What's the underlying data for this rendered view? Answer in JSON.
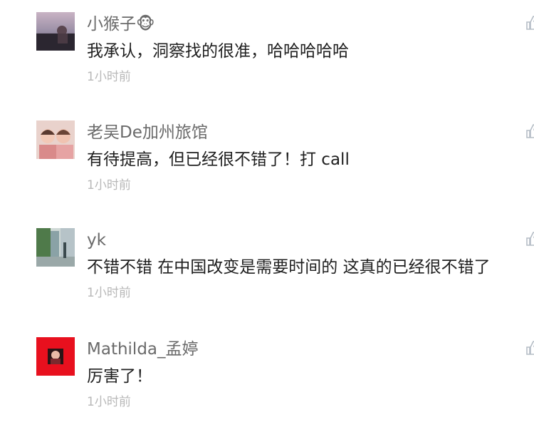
{
  "comments": [
    {
      "name": "小猴子🐵",
      "text": "我承认，洞察找的很准，哈哈哈哈哈",
      "time": "1小时前",
      "avatar_icon": "avatar-sunset-photo",
      "like_icon": "thumbs-up-icon"
    },
    {
      "name": "老吴De加州旅馆",
      "text": "有待提高，但已经很不错了！打 call",
      "time": "1小时前",
      "avatar_icon": "avatar-children-photo",
      "like_icon": "thumbs-up-icon"
    },
    {
      "name": "yk",
      "text": "不错不错  在中国改变是需要时间的 这真的已经很不错了",
      "time": "1小时前",
      "avatar_icon": "avatar-street-photo",
      "like_icon": "thumbs-up-icon"
    },
    {
      "name": "Mathilda_孟婷",
      "text": "厉害了！",
      "time": "1小时前",
      "avatar_icon": "avatar-red-portrait",
      "like_icon": "thumbs-up-icon"
    }
  ],
  "colors": {
    "name": "#6a6a6a",
    "text": "#1f1f1f",
    "time": "#b8b8b8",
    "like_icon": "#b5bdc6",
    "avatar_red": "#e8101e"
  }
}
